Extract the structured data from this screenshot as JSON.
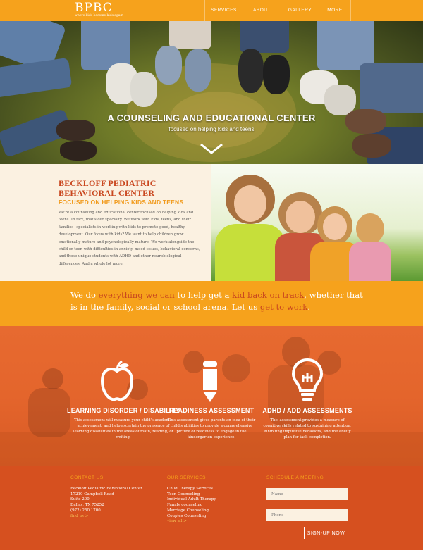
{
  "nav": {
    "logo": "BPBC",
    "tagline": "where kids become kids again",
    "items": [
      {
        "label": "SERVICES"
      },
      {
        "label": "ABOUT"
      },
      {
        "label": "GALLERY"
      },
      {
        "label": "MORE"
      }
    ]
  },
  "hero": {
    "title": "A COUNSELING AND EDUCATIONAL CENTER",
    "subtitle": "focused on helping kids and teens"
  },
  "about": {
    "title": "BECKLOFF PEDIATRIC BEHAVIORAL CENTER",
    "subtitle": "FOCUSED ON HELPING KIDS AND TEENS",
    "body": "We're a counseling and educational center focused on helping kids and teens. In fact, that's our specialty. We work with kids, teens, and their families– specialists in working with kids to promote good, healthy development. Our focus with kids? We want to help children grow emotionally mature and psychologically mature. We work alongside the child or teen with difficulties in anxiety, mood issues, behavioral concerns, and those unique students with ADHD and other neurobiological differences. And a whole lot more!"
  },
  "mission": {
    "p1": "We do ",
    "h1": "everything we can",
    "p2": " to help get a ",
    "h2": "kid back on track",
    "p3": ", whether that is in the family, social or school arena. Let us ",
    "h3": "get to work",
    "p4": "."
  },
  "services": [
    {
      "icon": "apple-icon",
      "title": "LEARNING DISORDER / DISABILITY",
      "body": "This assessment will measure your child's academic achievement, and help ascertain the presence of learning disabilities in the areas of math, reading, or writing."
    },
    {
      "icon": "pencil-icon",
      "title": "READINESS ASSESSMENT",
      "body": "This assessment gives parents an idea of their child's abilities to provide a comprehensive picture of readiness to engage in the kindergarten experience."
    },
    {
      "icon": "lightbulb-icon",
      "title": "ADHD / ADD ASSESSMENTS",
      "body": "This assessment provides a measure of cognitive skills related to sustaining attention, inhibiting impulsive behaviors, and the ability plan for task completion."
    }
  ],
  "footer": {
    "contact": {
      "heading": "CONTACT US",
      "lines": [
        "Beckloff Pediatric Behavioral Center",
        "17210 Campbell Road",
        "Suite 200",
        "Dallas, TX 75252",
        "(972) 250 1700"
      ],
      "link": "find us >"
    },
    "services": {
      "heading": "OUR SERVICES",
      "lines": [
        "Child Therapy Services",
        "Teen Counseling",
        "Individual Adult Therapy",
        "Family counseling",
        "Marriage Counseling",
        "Couples Counseling"
      ],
      "link": "view all >"
    },
    "schedule": {
      "heading": "SCHEDULE A MEETING",
      "name_placeholder": "Name",
      "phone_placeholder": "Phone",
      "button": "SIGN-UP NOW"
    }
  },
  "colors": {
    "orange": "#f6a21c",
    "rust": "#c9471f",
    "footer": "#d6501f",
    "cream": "#fbf1e1"
  }
}
